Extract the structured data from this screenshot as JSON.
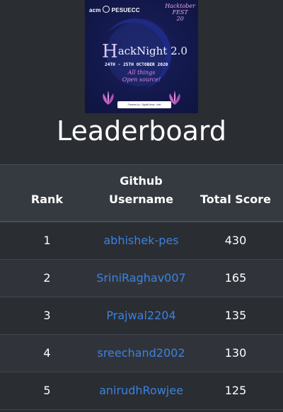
{
  "poster": {
    "org": "PESUECC",
    "acm": "acm",
    "fest_line1": "Hacktober",
    "fest_line2": "FEST",
    "fest_line3": "20",
    "title_initial": "H",
    "title_rest": "ackNight 2.0",
    "dates": "24TH - 25TH OCTOBER 2020",
    "tagline_line1": "All things",
    "tagline_line2": "Open source!",
    "sponsor_text": "Powered by · DigitalOcean · Intel",
    "colors": {
      "background": "#141a4f",
      "accent_pink": "#e08ad8"
    }
  },
  "page": {
    "title": "Leaderboard"
  },
  "table": {
    "headers": {
      "rank": "Rank",
      "github_line1": "Github",
      "github_line2": "Username",
      "score": "Total Score"
    },
    "rows": [
      {
        "rank": "1",
        "username": "abhishek-pes",
        "score": "430"
      },
      {
        "rank": "2",
        "username": "SriniRaghav007",
        "score": "165"
      },
      {
        "rank": "3",
        "username": "Prajwal2204",
        "score": "135"
      },
      {
        "rank": "4",
        "username": "sreechand2002",
        "score": "130"
      },
      {
        "rank": "5",
        "username": "anirudhRowjee",
        "score": "125"
      }
    ],
    "colors": {
      "link": "#3b82e0",
      "header_bg": "#353a41",
      "row_bg": "#2a2d32",
      "row_alt_bg": "#30343a"
    }
  }
}
